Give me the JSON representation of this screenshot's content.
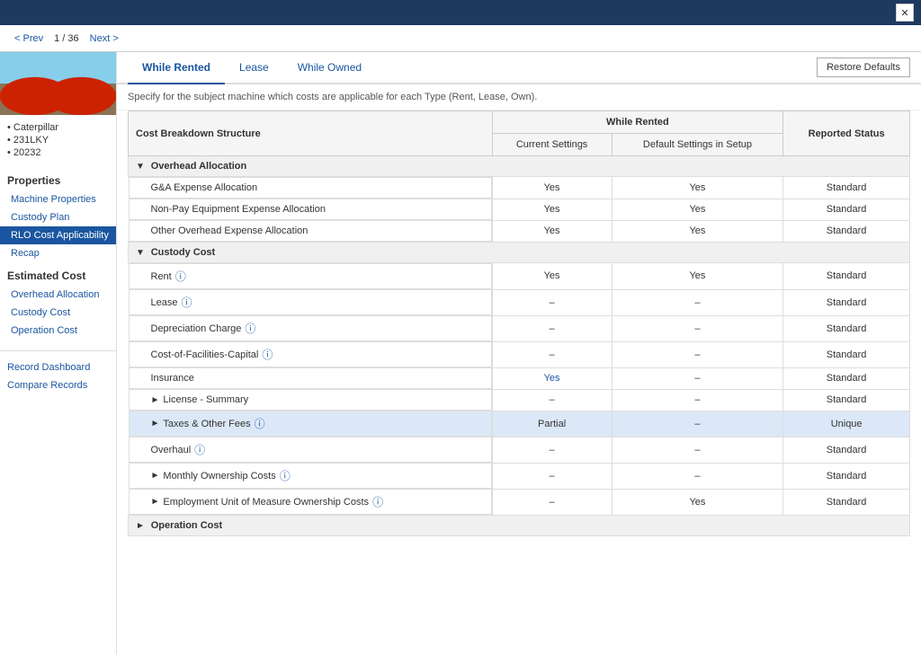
{
  "topbar": {
    "close_label": "✕"
  },
  "navbar": {
    "prev_label": "< Prev",
    "count": "1 / 36",
    "next_label": "Next >"
  },
  "sidebar": {
    "machine_info": [
      "Caterpillar",
      "231LKY",
      "20232"
    ],
    "properties_title": "Properties",
    "properties_items": [
      {
        "label": "Machine Properties",
        "active": false
      },
      {
        "label": "Custody Plan",
        "active": false
      },
      {
        "label": "RLO Cost Applicability",
        "active": true
      },
      {
        "label": "Recap",
        "active": false
      }
    ],
    "estimated_cost_title": "Estimated Cost",
    "estimated_cost_items": [
      {
        "label": "Overhead Allocation",
        "active": false
      },
      {
        "label": "Custody Cost",
        "active": false
      },
      {
        "label": "Operation Cost",
        "active": false
      }
    ],
    "record_dashboard_label": "Record Dashboard",
    "compare_records_label": "Compare Records"
  },
  "tabs": [
    {
      "label": "While Rented",
      "active": true
    },
    {
      "label": "Lease",
      "active": false
    },
    {
      "label": "While Owned",
      "active": false
    }
  ],
  "restore_defaults_label": "Restore Defaults",
  "description": "Specify for the subject machine which costs are applicable for each Type (Rent, Lease, Own).",
  "table": {
    "col_headers": {
      "cost_breakdown": "Cost Breakdown Structure",
      "while_rented": "While Rented",
      "reported_status": "Reported Status"
    },
    "sub_headers": {
      "current_settings": "Current Settings",
      "default_settings": "Default Settings in Setup"
    },
    "sections": [
      {
        "type": "group",
        "label": "Overhead Allocation",
        "expanded": true,
        "rows": [
          {
            "name": "G&A Expense Allocation",
            "info": false,
            "current": "Yes",
            "default": "Yes",
            "status": "Standard",
            "highlight": false
          },
          {
            "name": "Non-Pay Equipment Expense Allocation",
            "info": false,
            "current": "Yes",
            "default": "Yes",
            "status": "Standard",
            "highlight": false
          },
          {
            "name": "Other Overhead Expense Allocation",
            "info": false,
            "current": "Yes",
            "default": "Yes",
            "status": "Standard",
            "highlight": false
          }
        ]
      },
      {
        "type": "group",
        "label": "Custody Cost",
        "expanded": true,
        "rows": [
          {
            "name": "Rent",
            "info": true,
            "current": "Yes",
            "default": "Yes",
            "status": "Standard",
            "highlight": false
          },
          {
            "name": "Lease",
            "info": true,
            "current": "–",
            "default": "–",
            "status": "Standard",
            "highlight": false
          },
          {
            "name": "Depreciation Charge",
            "info": true,
            "current": "–",
            "default": "–",
            "status": "Standard",
            "highlight": false
          },
          {
            "name": "Cost-of-Facilities-Capital",
            "info": true,
            "current": "–",
            "default": "–",
            "status": "Standard",
            "highlight": false
          },
          {
            "name": "Insurance",
            "info": false,
            "current": "Yes",
            "current_link": true,
            "default": "–",
            "status": "Standard",
            "highlight": false
          },
          {
            "name": "License - Summary",
            "info": false,
            "current": "–",
            "default": "–",
            "status": "Standard",
            "highlight": false,
            "expandable": true
          },
          {
            "name": "Taxes & Other Fees",
            "info": true,
            "current": "Partial",
            "current_link": false,
            "default": "–",
            "status": "Unique",
            "highlight": true,
            "expandable": true
          },
          {
            "name": "Overhaul",
            "info": true,
            "current": "–",
            "default": "–",
            "status": "Standard",
            "highlight": false
          },
          {
            "name": "Monthly Ownership Costs",
            "info": true,
            "current": "–",
            "default": "–",
            "status": "Standard",
            "highlight": false,
            "expandable": true
          },
          {
            "name": "Employment Unit of Measure Ownership Costs",
            "info": true,
            "current": "–",
            "default": "Yes",
            "status": "Standard",
            "highlight": false,
            "expandable": true
          }
        ]
      },
      {
        "type": "group",
        "label": "Operation Cost",
        "expanded": false,
        "rows": []
      }
    ]
  }
}
